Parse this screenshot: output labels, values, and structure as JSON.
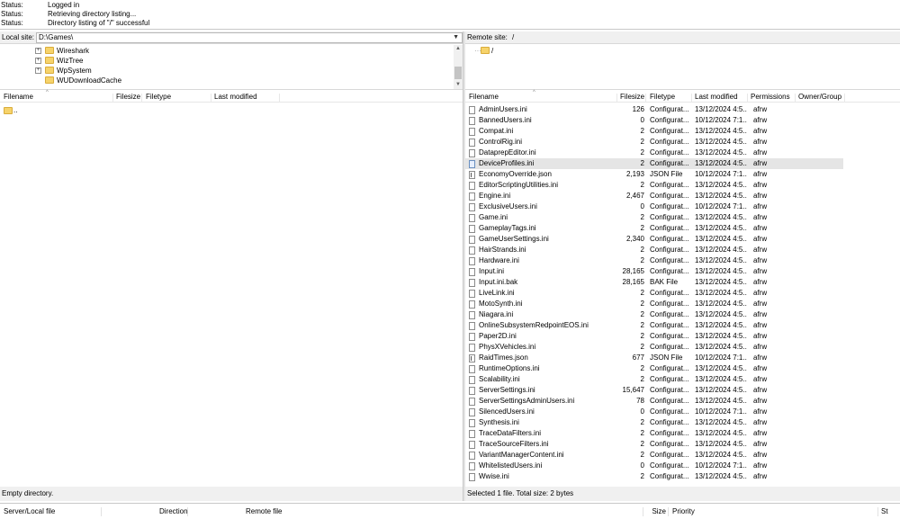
{
  "log": [
    {
      "label": "Status:",
      "message": "Logged in"
    },
    {
      "label": "Status:",
      "message": "Retrieving directory listing..."
    },
    {
      "label": "Status:",
      "message": "Directory listing of \"/\" successful"
    }
  ],
  "local": {
    "site_label": "Local site:",
    "path": "D:\\Games\\",
    "tree": [
      "Wireshark",
      "WizTree",
      "WpSystem",
      "WUDownloadCache"
    ],
    "columns": [
      "Filename",
      "Filesize",
      "Filetype",
      "Last modified"
    ],
    "rows": [
      ".."
    ],
    "status": "Empty directory."
  },
  "remote": {
    "site_label": "Remote site:",
    "path": "/",
    "tree_root": "/",
    "columns": [
      "Filename",
      "Filesize",
      "Filetype",
      "Last modified",
      "Permissions",
      "Owner/Group"
    ],
    "selected_index": 5,
    "files": [
      {
        "name": "AdminUsers.ini",
        "size": "126",
        "type": "Configurat...",
        "modified": "13/12/2024 4:5...",
        "perm": "afrw",
        "icon": "ini"
      },
      {
        "name": "BannedUsers.ini",
        "size": "0",
        "type": "Configurat...",
        "modified": "10/12/2024 7:1...",
        "perm": "afrw",
        "icon": "ini"
      },
      {
        "name": "Compat.ini",
        "size": "2",
        "type": "Configurat...",
        "modified": "13/12/2024 4:5...",
        "perm": "afrw",
        "icon": "ini"
      },
      {
        "name": "ControlRig.ini",
        "size": "2",
        "type": "Configurat...",
        "modified": "13/12/2024 4:5...",
        "perm": "afrw",
        "icon": "ini"
      },
      {
        "name": "DataprepEditor.ini",
        "size": "2",
        "type": "Configurat...",
        "modified": "13/12/2024 4:5...",
        "perm": "afrw",
        "icon": "ini"
      },
      {
        "name": "DeviceProfiles.ini",
        "size": "2",
        "type": "Configurat...",
        "modified": "13/12/2024 4:5...",
        "perm": "afrw",
        "icon": "ini"
      },
      {
        "name": "EconomyOverride.json",
        "size": "2,193",
        "type": "JSON File",
        "modified": "10/12/2024 7:1...",
        "perm": "afrw",
        "icon": "json"
      },
      {
        "name": "EditorScriptingUtilities.ini",
        "size": "2",
        "type": "Configurat...",
        "modified": "13/12/2024 4:5...",
        "perm": "afrw",
        "icon": "ini"
      },
      {
        "name": "Engine.ini",
        "size": "2,467",
        "type": "Configurat...",
        "modified": "13/12/2024 4:5...",
        "perm": "afrw",
        "icon": "ini"
      },
      {
        "name": "ExclusiveUsers.ini",
        "size": "0",
        "type": "Configurat...",
        "modified": "10/12/2024 7:1...",
        "perm": "afrw",
        "icon": "ini"
      },
      {
        "name": "Game.ini",
        "size": "2",
        "type": "Configurat...",
        "modified": "13/12/2024 4:5...",
        "perm": "afrw",
        "icon": "ini"
      },
      {
        "name": "GameplayTags.ini",
        "size": "2",
        "type": "Configurat...",
        "modified": "13/12/2024 4:5...",
        "perm": "afrw",
        "icon": "ini"
      },
      {
        "name": "GameUserSettings.ini",
        "size": "2,340",
        "type": "Configurat...",
        "modified": "13/12/2024 4:5...",
        "perm": "afrw",
        "icon": "ini"
      },
      {
        "name": "HairStrands.ini",
        "size": "2",
        "type": "Configurat...",
        "modified": "13/12/2024 4:5...",
        "perm": "afrw",
        "icon": "ini"
      },
      {
        "name": "Hardware.ini",
        "size": "2",
        "type": "Configurat...",
        "modified": "13/12/2024 4:5...",
        "perm": "afrw",
        "icon": "ini"
      },
      {
        "name": "Input.ini",
        "size": "28,165",
        "type": "Configurat...",
        "modified": "13/12/2024 4:5...",
        "perm": "afrw",
        "icon": "ini"
      },
      {
        "name": "Input.ini.bak",
        "size": "28,165",
        "type": "BAK File",
        "modified": "13/12/2024 4:5...",
        "perm": "afrw",
        "icon": "ini"
      },
      {
        "name": "LiveLink.ini",
        "size": "2",
        "type": "Configurat...",
        "modified": "13/12/2024 4:5...",
        "perm": "afrw",
        "icon": "ini"
      },
      {
        "name": "MotoSynth.ini",
        "size": "2",
        "type": "Configurat...",
        "modified": "13/12/2024 4:5...",
        "perm": "afrw",
        "icon": "ini"
      },
      {
        "name": "Niagara.ini",
        "size": "2",
        "type": "Configurat...",
        "modified": "13/12/2024 4:5...",
        "perm": "afrw",
        "icon": "ini"
      },
      {
        "name": "OnlineSubsystemRedpointEOS.ini",
        "size": "2",
        "type": "Configurat...",
        "modified": "13/12/2024 4:5...",
        "perm": "afrw",
        "icon": "ini"
      },
      {
        "name": "Paper2D.ini",
        "size": "2",
        "type": "Configurat...",
        "modified": "13/12/2024 4:5...",
        "perm": "afrw",
        "icon": "ini"
      },
      {
        "name": "PhysXVehicles.ini",
        "size": "2",
        "type": "Configurat...",
        "modified": "13/12/2024 4:5...",
        "perm": "afrw",
        "icon": "ini"
      },
      {
        "name": "RaidTimes.json",
        "size": "677",
        "type": "JSON File",
        "modified": "10/12/2024 7:1...",
        "perm": "afrw",
        "icon": "json"
      },
      {
        "name": "RuntimeOptions.ini",
        "size": "2",
        "type": "Configurat...",
        "modified": "13/12/2024 4:5...",
        "perm": "afrw",
        "icon": "ini"
      },
      {
        "name": "Scalability.ini",
        "size": "2",
        "type": "Configurat...",
        "modified": "13/12/2024 4:5...",
        "perm": "afrw",
        "icon": "ini"
      },
      {
        "name": "ServerSettings.ini",
        "size": "15,647",
        "type": "Configurat...",
        "modified": "13/12/2024 4:5...",
        "perm": "afrw",
        "icon": "ini"
      },
      {
        "name": "ServerSettingsAdminUsers.ini",
        "size": "78",
        "type": "Configurat...",
        "modified": "13/12/2024 4:5...",
        "perm": "afrw",
        "icon": "ini"
      },
      {
        "name": "SilencedUsers.ini",
        "size": "0",
        "type": "Configurat...",
        "modified": "10/12/2024 7:1...",
        "perm": "afrw",
        "icon": "ini"
      },
      {
        "name": "Synthesis.ini",
        "size": "2",
        "type": "Configurat...",
        "modified": "13/12/2024 4:5...",
        "perm": "afrw",
        "icon": "ini"
      },
      {
        "name": "TraceDataFilters.ini",
        "size": "2",
        "type": "Configurat...",
        "modified": "13/12/2024 4:5...",
        "perm": "afrw",
        "icon": "ini"
      },
      {
        "name": "TraceSourceFilters.ini",
        "size": "2",
        "type": "Configurat...",
        "modified": "13/12/2024 4:5...",
        "perm": "afrw",
        "icon": "ini"
      },
      {
        "name": "VariantManagerContent.ini",
        "size": "2",
        "type": "Configurat...",
        "modified": "13/12/2024 4:5...",
        "perm": "afrw",
        "icon": "ini"
      },
      {
        "name": "WhitelistedUsers.ini",
        "size": "0",
        "type": "Configurat...",
        "modified": "10/12/2024 7:1...",
        "perm": "afrw",
        "icon": "ini"
      },
      {
        "name": "Wwise.ini",
        "size": "2",
        "type": "Configurat...",
        "modified": "13/12/2024 4:5...",
        "perm": "afrw",
        "icon": "ini"
      }
    ],
    "status": "Selected 1 file. Total size: 2 bytes"
  },
  "queue": {
    "columns": [
      "Server/Local file",
      "Direction",
      "Remote file",
      "Size",
      "Priority",
      "St"
    ]
  },
  "colors": {
    "folder": "#f6d36b",
    "selected_row": "#e5e5e5",
    "bar": "#f0f0f0"
  }
}
